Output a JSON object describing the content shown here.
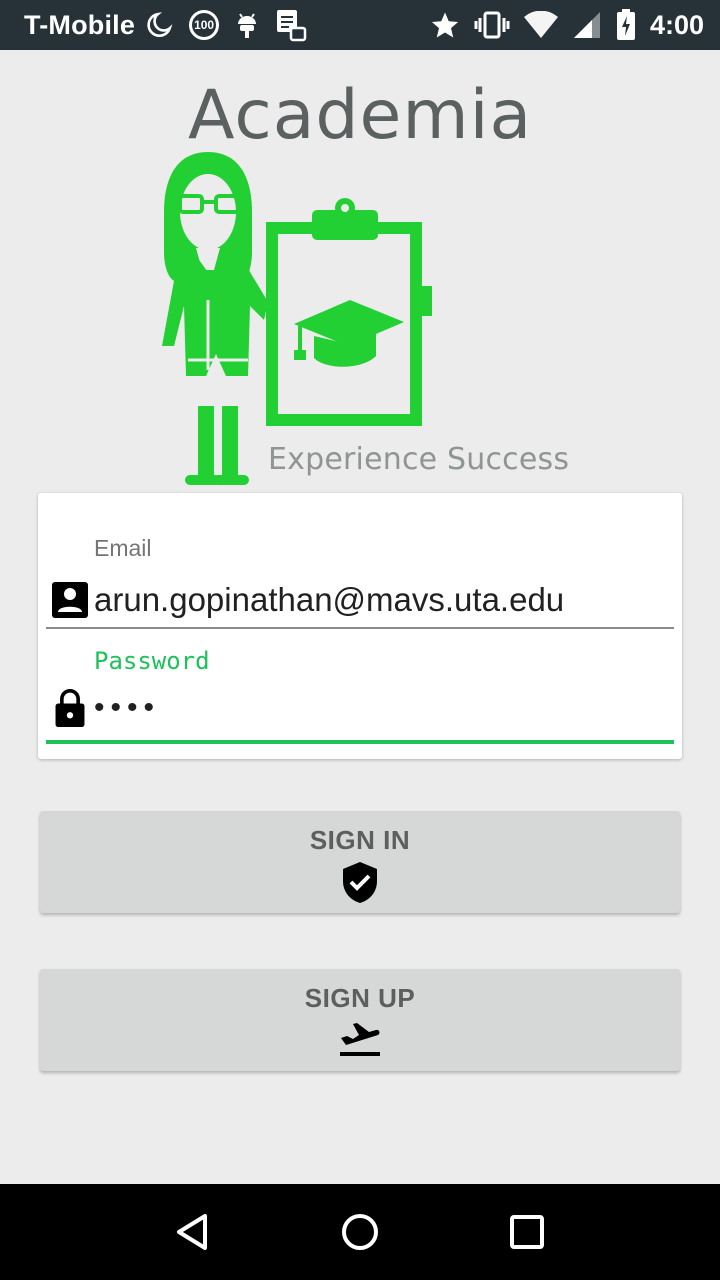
{
  "status_bar": {
    "carrier": "T-Mobile",
    "battery_saver_badge": "100",
    "time": "4:00",
    "icons": [
      "moon-icon",
      "hundred-badge-icon",
      "android-debug-icon",
      "notification-sync-icon",
      "star-icon",
      "vibrate-icon",
      "wifi-icon",
      "signal-icon",
      "battery-charging-icon"
    ]
  },
  "logo": {
    "title": "Academia",
    "tagline": "Experience Success",
    "accent_color": "#22d033"
  },
  "login_form": {
    "email_label": "Email",
    "email_value": "arun.gopinathan@mavs.uta.edu",
    "password_label": "Password",
    "password_value": "••••",
    "focus_color": "#1ec25a"
  },
  "buttons": {
    "sign_in_label": "SIGN IN",
    "sign_up_label": "SIGN UP"
  },
  "nav_bar": {
    "icons": [
      "back-icon",
      "home-icon",
      "recents-icon"
    ]
  }
}
